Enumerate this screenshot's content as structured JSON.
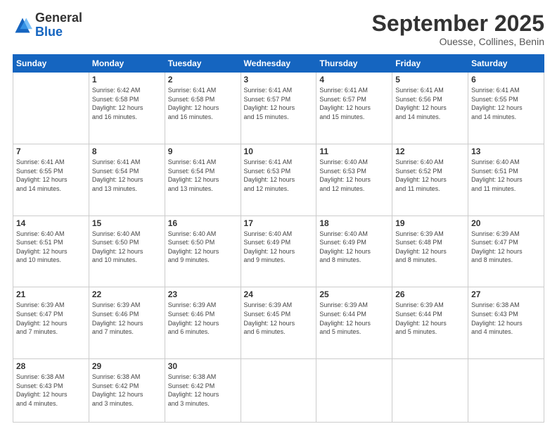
{
  "header": {
    "logo_general": "General",
    "logo_blue": "Blue",
    "month_title": "September 2025",
    "location": "Ouesse, Collines, Benin"
  },
  "days_of_week": [
    "Sunday",
    "Monday",
    "Tuesday",
    "Wednesday",
    "Thursday",
    "Friday",
    "Saturday"
  ],
  "weeks": [
    [
      {
        "day": "",
        "info": ""
      },
      {
        "day": "1",
        "info": "Sunrise: 6:42 AM\nSunset: 6:58 PM\nDaylight: 12 hours\nand 16 minutes."
      },
      {
        "day": "2",
        "info": "Sunrise: 6:41 AM\nSunset: 6:58 PM\nDaylight: 12 hours\nand 16 minutes."
      },
      {
        "day": "3",
        "info": "Sunrise: 6:41 AM\nSunset: 6:57 PM\nDaylight: 12 hours\nand 15 minutes."
      },
      {
        "day": "4",
        "info": "Sunrise: 6:41 AM\nSunset: 6:57 PM\nDaylight: 12 hours\nand 15 minutes."
      },
      {
        "day": "5",
        "info": "Sunrise: 6:41 AM\nSunset: 6:56 PM\nDaylight: 12 hours\nand 14 minutes."
      },
      {
        "day": "6",
        "info": "Sunrise: 6:41 AM\nSunset: 6:55 PM\nDaylight: 12 hours\nand 14 minutes."
      }
    ],
    [
      {
        "day": "7",
        "info": "Sunrise: 6:41 AM\nSunset: 6:55 PM\nDaylight: 12 hours\nand 14 minutes."
      },
      {
        "day": "8",
        "info": "Sunrise: 6:41 AM\nSunset: 6:54 PM\nDaylight: 12 hours\nand 13 minutes."
      },
      {
        "day": "9",
        "info": "Sunrise: 6:41 AM\nSunset: 6:54 PM\nDaylight: 12 hours\nand 13 minutes."
      },
      {
        "day": "10",
        "info": "Sunrise: 6:41 AM\nSunset: 6:53 PM\nDaylight: 12 hours\nand 12 minutes."
      },
      {
        "day": "11",
        "info": "Sunrise: 6:40 AM\nSunset: 6:53 PM\nDaylight: 12 hours\nand 12 minutes."
      },
      {
        "day": "12",
        "info": "Sunrise: 6:40 AM\nSunset: 6:52 PM\nDaylight: 12 hours\nand 11 minutes."
      },
      {
        "day": "13",
        "info": "Sunrise: 6:40 AM\nSunset: 6:51 PM\nDaylight: 12 hours\nand 11 minutes."
      }
    ],
    [
      {
        "day": "14",
        "info": "Sunrise: 6:40 AM\nSunset: 6:51 PM\nDaylight: 12 hours\nand 10 minutes."
      },
      {
        "day": "15",
        "info": "Sunrise: 6:40 AM\nSunset: 6:50 PM\nDaylight: 12 hours\nand 10 minutes."
      },
      {
        "day": "16",
        "info": "Sunrise: 6:40 AM\nSunset: 6:50 PM\nDaylight: 12 hours\nand 9 minutes."
      },
      {
        "day": "17",
        "info": "Sunrise: 6:40 AM\nSunset: 6:49 PM\nDaylight: 12 hours\nand 9 minutes."
      },
      {
        "day": "18",
        "info": "Sunrise: 6:40 AM\nSunset: 6:49 PM\nDaylight: 12 hours\nand 8 minutes."
      },
      {
        "day": "19",
        "info": "Sunrise: 6:39 AM\nSunset: 6:48 PM\nDaylight: 12 hours\nand 8 minutes."
      },
      {
        "day": "20",
        "info": "Sunrise: 6:39 AM\nSunset: 6:47 PM\nDaylight: 12 hours\nand 8 minutes."
      }
    ],
    [
      {
        "day": "21",
        "info": "Sunrise: 6:39 AM\nSunset: 6:47 PM\nDaylight: 12 hours\nand 7 minutes."
      },
      {
        "day": "22",
        "info": "Sunrise: 6:39 AM\nSunset: 6:46 PM\nDaylight: 12 hours\nand 7 minutes."
      },
      {
        "day": "23",
        "info": "Sunrise: 6:39 AM\nSunset: 6:46 PM\nDaylight: 12 hours\nand 6 minutes."
      },
      {
        "day": "24",
        "info": "Sunrise: 6:39 AM\nSunset: 6:45 PM\nDaylight: 12 hours\nand 6 minutes."
      },
      {
        "day": "25",
        "info": "Sunrise: 6:39 AM\nSunset: 6:44 PM\nDaylight: 12 hours\nand 5 minutes."
      },
      {
        "day": "26",
        "info": "Sunrise: 6:39 AM\nSunset: 6:44 PM\nDaylight: 12 hours\nand 5 minutes."
      },
      {
        "day": "27",
        "info": "Sunrise: 6:38 AM\nSunset: 6:43 PM\nDaylight: 12 hours\nand 4 minutes."
      }
    ],
    [
      {
        "day": "28",
        "info": "Sunrise: 6:38 AM\nSunset: 6:43 PM\nDaylight: 12 hours\nand 4 minutes."
      },
      {
        "day": "29",
        "info": "Sunrise: 6:38 AM\nSunset: 6:42 PM\nDaylight: 12 hours\nand 3 minutes."
      },
      {
        "day": "30",
        "info": "Sunrise: 6:38 AM\nSunset: 6:42 PM\nDaylight: 12 hours\nand 3 minutes."
      },
      {
        "day": "",
        "info": ""
      },
      {
        "day": "",
        "info": ""
      },
      {
        "day": "",
        "info": ""
      },
      {
        "day": "",
        "info": ""
      }
    ]
  ]
}
